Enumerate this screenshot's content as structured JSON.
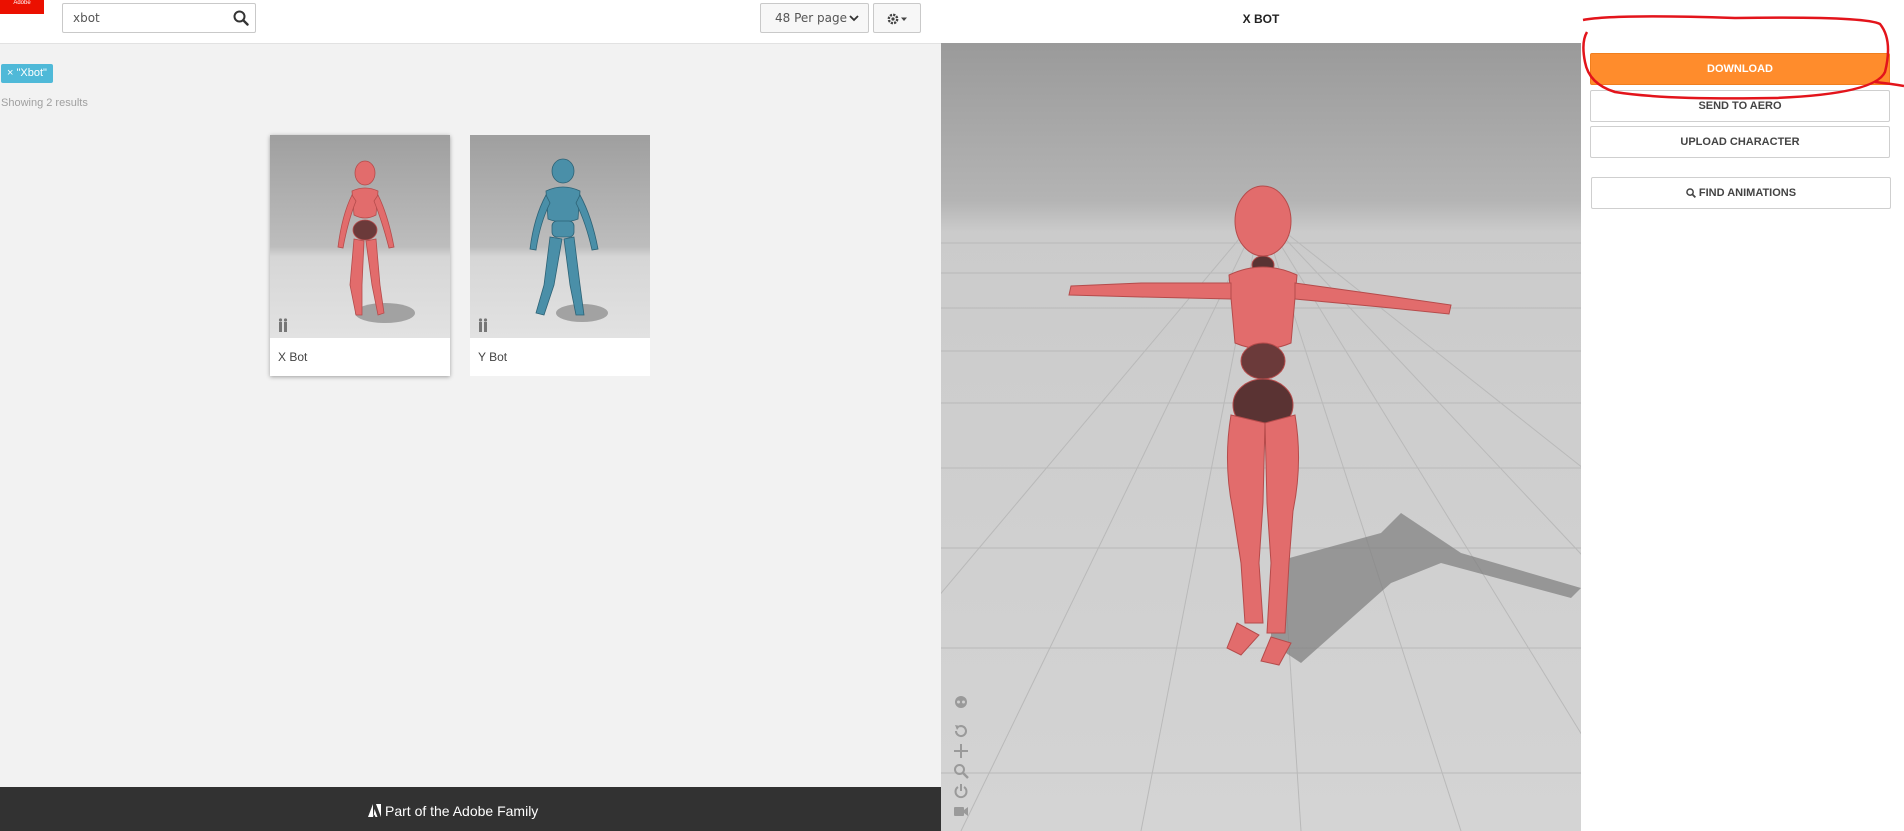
{
  "logo": {
    "text": "Adobe"
  },
  "search": {
    "value": "xbot"
  },
  "per_page": {
    "selected": "48 Per page"
  },
  "filter_tag": {
    "label": "× \"Xbot\""
  },
  "results": {
    "summary": "Showing 2 results"
  },
  "cards": [
    {
      "name": "X Bot",
      "color": "#e26c6c",
      "selected": true
    },
    {
      "name": "Y Bot",
      "color": "#4a8fa8",
      "selected": false
    }
  ],
  "footer": {
    "text": "Part of the Adobe Family"
  },
  "viewer": {
    "title": "X BOT"
  },
  "actions": {
    "download": "DOWNLOAD",
    "send_to_aero": "SEND TO AERO",
    "upload_character": "UPLOAD CHARACTER",
    "find_animations": "FIND ANIMATIONS"
  },
  "colors": {
    "accent": "#ff8c2c",
    "tag": "#4fb9d8",
    "annotation": "#e3141b"
  }
}
